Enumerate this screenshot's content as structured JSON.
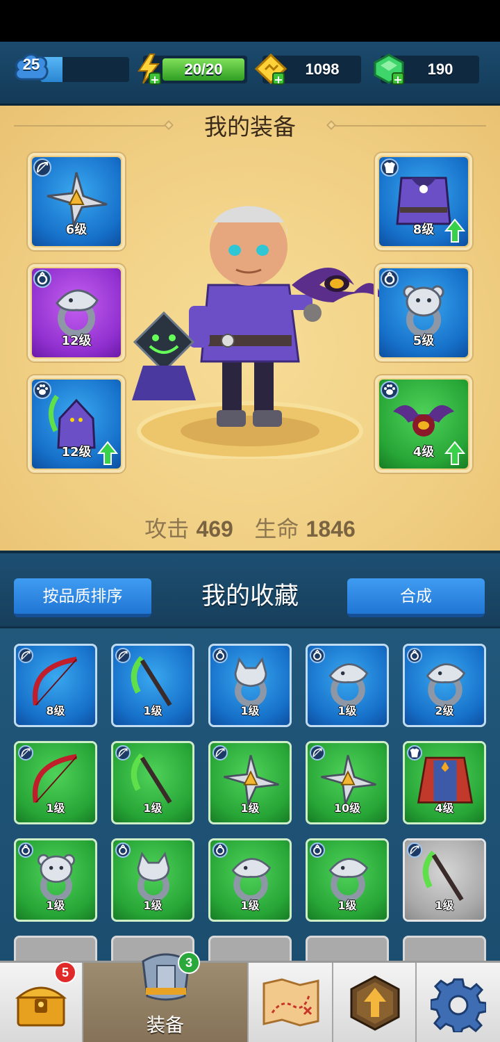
{
  "header": {
    "player_level": "25",
    "xp_progress": 0.25,
    "energy": "20/20",
    "gold": "1098",
    "gems": "190"
  },
  "equipment": {
    "title": "我的装备",
    "slots": [
      {
        "id": "weapon",
        "type_icon": "bow-slot-icon",
        "item": "shuriken",
        "level": "6级",
        "quality": "blue",
        "upgrade": false
      },
      {
        "id": "ring-1",
        "type_icon": "ring-slot-icon",
        "item": "dragon-ring",
        "level": "12级",
        "quality": "purple",
        "upgrade": false
      },
      {
        "id": "pet-1",
        "type_icon": "paw-slot-icon",
        "item": "reaper-pet",
        "level": "12级",
        "quality": "blue",
        "upgrade": true
      },
      {
        "id": "armor",
        "type_icon": "armor-slot-icon",
        "item": "purple-robe",
        "level": "8级",
        "quality": "blue",
        "upgrade": true
      },
      {
        "id": "ring-2",
        "type_icon": "ring-slot-icon",
        "item": "bear-ring",
        "level": "5级",
        "quality": "blue",
        "upgrade": false
      },
      {
        "id": "pet-2",
        "type_icon": "paw-slot-icon",
        "item": "bat-pet",
        "level": "4级",
        "quality": "green",
        "upgrade": true
      }
    ],
    "stats": {
      "attack_label": "攻击",
      "attack": "469",
      "hp_label": "生命",
      "hp": "1846"
    }
  },
  "collection": {
    "title": "我的收藏",
    "sort_button": "按品质排序",
    "merge_button": "合成",
    "items": [
      {
        "item": "red-bow",
        "type_icon": "bow-slot-icon",
        "level": "8级",
        "quality": "blue"
      },
      {
        "item": "green-scythe",
        "type_icon": "bow-slot-icon",
        "level": "1级",
        "quality": "blue"
      },
      {
        "item": "wolf-ring",
        "type_icon": "ring-slot-icon",
        "level": "1级",
        "quality": "blue"
      },
      {
        "item": "dragon-ring",
        "type_icon": "ring-slot-icon",
        "level": "1级",
        "quality": "blue"
      },
      {
        "item": "dragon-ring",
        "type_icon": "ring-slot-icon",
        "level": "2级",
        "quality": "blue"
      },
      {
        "item": "red-bow",
        "type_icon": "bow-slot-icon",
        "level": "1级",
        "quality": "green"
      },
      {
        "item": "green-scythe",
        "type_icon": "bow-slot-icon",
        "level": "1级",
        "quality": "green"
      },
      {
        "item": "shuriken",
        "type_icon": "bow-slot-icon",
        "level": "1级",
        "quality": "green"
      },
      {
        "item": "shuriken",
        "type_icon": "bow-slot-icon",
        "level": "10级",
        "quality": "green"
      },
      {
        "item": "red-robe",
        "type_icon": "armor-slot-icon",
        "level": "4级",
        "quality": "green"
      },
      {
        "item": "bear-ring",
        "type_icon": "ring-slot-icon",
        "level": "1级",
        "quality": "green"
      },
      {
        "item": "wolf-ring",
        "type_icon": "ring-slot-icon",
        "level": "1级",
        "quality": "green"
      },
      {
        "item": "dragon-ring",
        "type_icon": "ring-slot-icon",
        "level": "1级",
        "quality": "green"
      },
      {
        "item": "dragon-ring",
        "type_icon": "ring-slot-icon",
        "level": "1级",
        "quality": "green"
      },
      {
        "item": "green-scythe",
        "type_icon": "bow-slot-icon",
        "level": "1级",
        "quality": "gray"
      }
    ]
  },
  "nav": {
    "chest_badge": "5",
    "equip_label": "装备",
    "equip_badge": "3",
    "items": [
      "chest-icon",
      "armor-icon",
      "map-icon",
      "upgrade-icon",
      "settings-icon"
    ]
  },
  "colors": {
    "panel": "#f0cf83",
    "collection_bg": "#1b4d6f",
    "quality_blue": "#1670c9",
    "quality_purple": "#9030cf",
    "quality_green": "#27a536",
    "quality_gray": "#a9a9a9",
    "button": "#2f89e3"
  }
}
